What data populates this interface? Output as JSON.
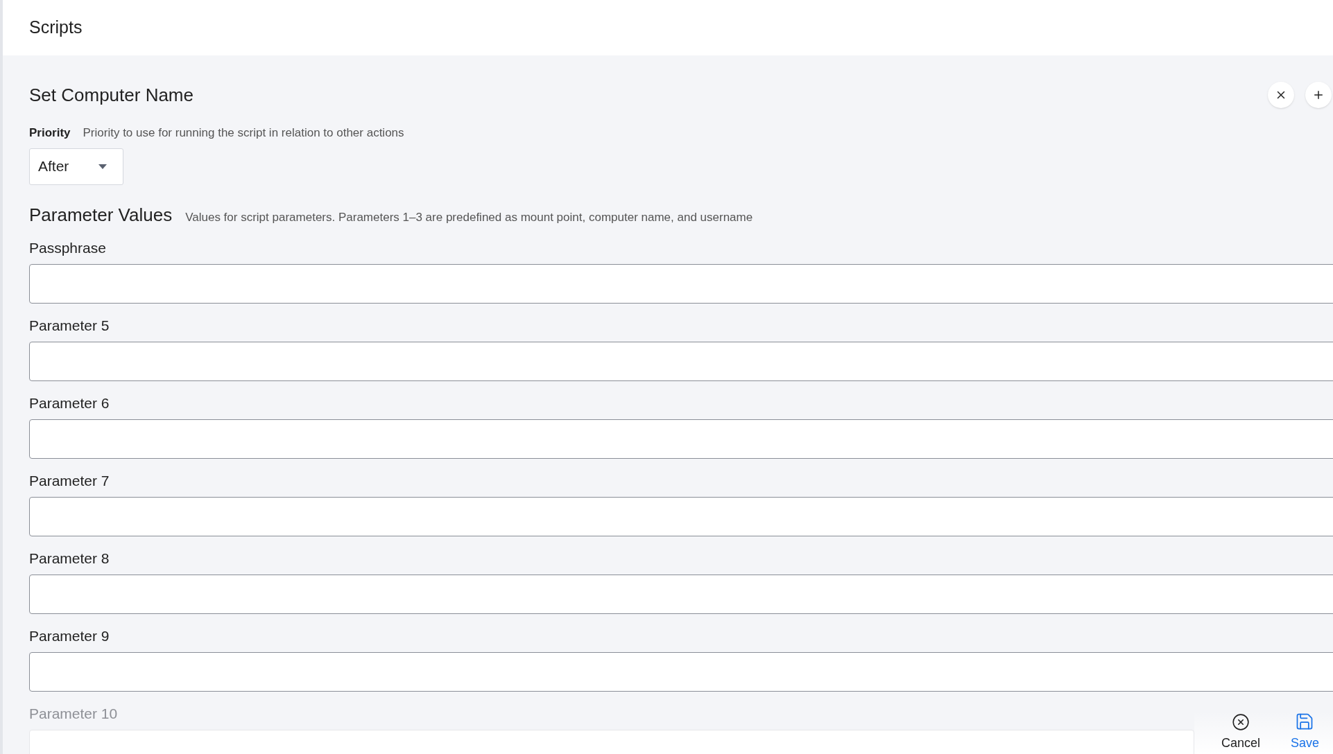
{
  "header": {
    "title": "Scripts"
  },
  "script": {
    "title": "Set Computer Name"
  },
  "priority": {
    "label": "Priority",
    "description": "Priority to use for running the script in relation to other actions",
    "value": "After"
  },
  "parameters": {
    "title": "Parameter Values",
    "description": "Values for script parameters. Parameters 1–3 are predefined as mount point, computer name, and username",
    "fields": [
      {
        "label": "Passphrase",
        "faded": false
      },
      {
        "label": "Parameter 5",
        "faded": false
      },
      {
        "label": "Parameter 6",
        "faded": false
      },
      {
        "label": "Parameter 7",
        "faded": false
      },
      {
        "label": "Parameter 8",
        "faded": false
      },
      {
        "label": "Parameter 9",
        "faded": false
      },
      {
        "label": "Parameter 10",
        "faded": true
      }
    ]
  },
  "footer": {
    "buttons": [
      {
        "label": "Cancel",
        "kind": "cancel"
      },
      {
        "label": "Save",
        "kind": "save"
      }
    ]
  }
}
